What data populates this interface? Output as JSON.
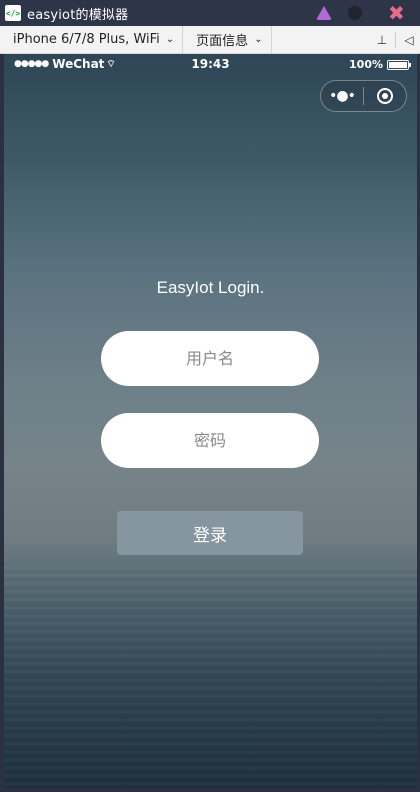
{
  "window": {
    "app_icon_glyph": "</>",
    "title": "easyiot的模拟器",
    "controls": {
      "triangle_color": "#b36ad9",
      "close_color": "#e86b8b",
      "close_glyph": "✖"
    }
  },
  "toolbar": {
    "device_select": "iPhone 6/7/8 Plus, WiFi",
    "page_info_select": "页面信息",
    "chevron": "⌄",
    "pin_icon": "pin-icon",
    "pin_glyph": "⊥",
    "sound_icon": "speaker-icon",
    "sound_glyph": "◁"
  },
  "status_bar": {
    "signal_dots": "●●●●●",
    "carrier": "WeChat",
    "wifi_glyph": "⌔",
    "time": "19:43",
    "battery_percent": "100%",
    "battery_level": 1.0
  },
  "capsule": {
    "more_glyph": "•●•",
    "more_icon": "more-dots-icon",
    "close_icon": "target-icon"
  },
  "login": {
    "title": "EasyIot Login.",
    "username_placeholder": "用户名",
    "password_placeholder": "密码",
    "submit_label": "登录"
  },
  "colors": {
    "button_bg": "#8696a0",
    "title_bar_bg": "#2f3548"
  }
}
